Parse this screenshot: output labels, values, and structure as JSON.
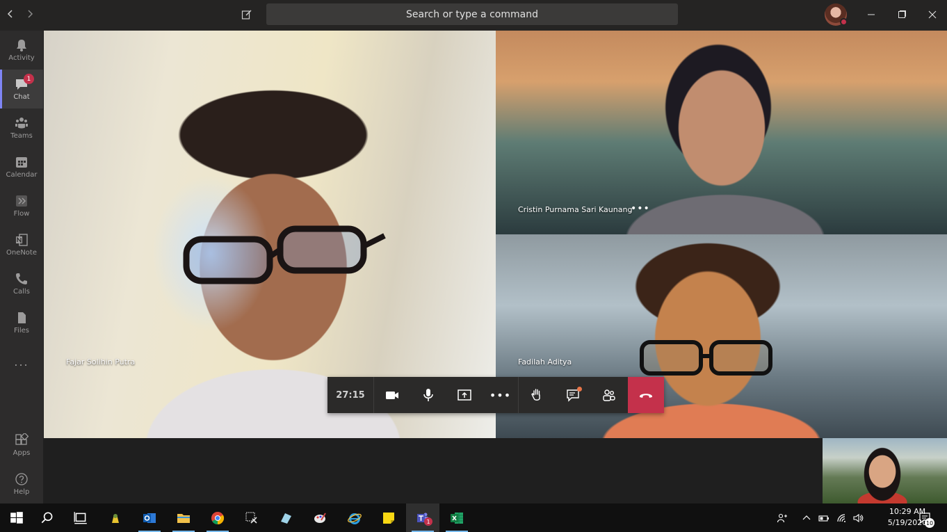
{
  "titlebar": {
    "search_placeholder": "Search or type a command"
  },
  "rail": {
    "items": [
      {
        "label": "Activity",
        "icon": "bell-icon"
      },
      {
        "label": "Chat",
        "icon": "chat-icon",
        "badge": "1"
      },
      {
        "label": "Teams",
        "icon": "teams-icon"
      },
      {
        "label": "Calendar",
        "icon": "calendar-icon"
      },
      {
        "label": "Flow",
        "icon": "flow-icon"
      },
      {
        "label": "OneNote",
        "icon": "onenote-icon"
      },
      {
        "label": "Calls",
        "icon": "phone-icon"
      },
      {
        "label": "Files",
        "icon": "files-icon"
      },
      {
        "label": "...",
        "icon": "more-icon"
      }
    ],
    "bottom_items": [
      {
        "label": "Apps",
        "icon": "apps-icon"
      },
      {
        "label": "Help",
        "icon": "help-icon"
      }
    ]
  },
  "call": {
    "participants": [
      {
        "name": "Fajar Solihin Putra"
      },
      {
        "name": "Cristin Purnama Sari Kaunang",
        "more": "•••"
      },
      {
        "name": "Fadilah Aditya"
      }
    ],
    "controls": {
      "timer": "27:15",
      "more": "•••"
    }
  },
  "taskbar": {
    "apps": [
      {
        "name": "Outlook",
        "icon": "outlook-icon"
      },
      {
        "name": "File Explorer",
        "icon": "folder-icon"
      },
      {
        "name": "Chrome",
        "icon": "chrome-icon"
      },
      {
        "name": "Teams",
        "icon": "teams-icon",
        "badge": "1"
      },
      {
        "name": "Excel",
        "icon": "excel-icon"
      }
    ],
    "clock_time": "10:29 AM",
    "clock_date": "5/19/2020",
    "notification_count": "10"
  },
  "colors": {
    "accent": "#7f85f5",
    "hangup": "#c4314b",
    "badge": "#c4314b"
  }
}
